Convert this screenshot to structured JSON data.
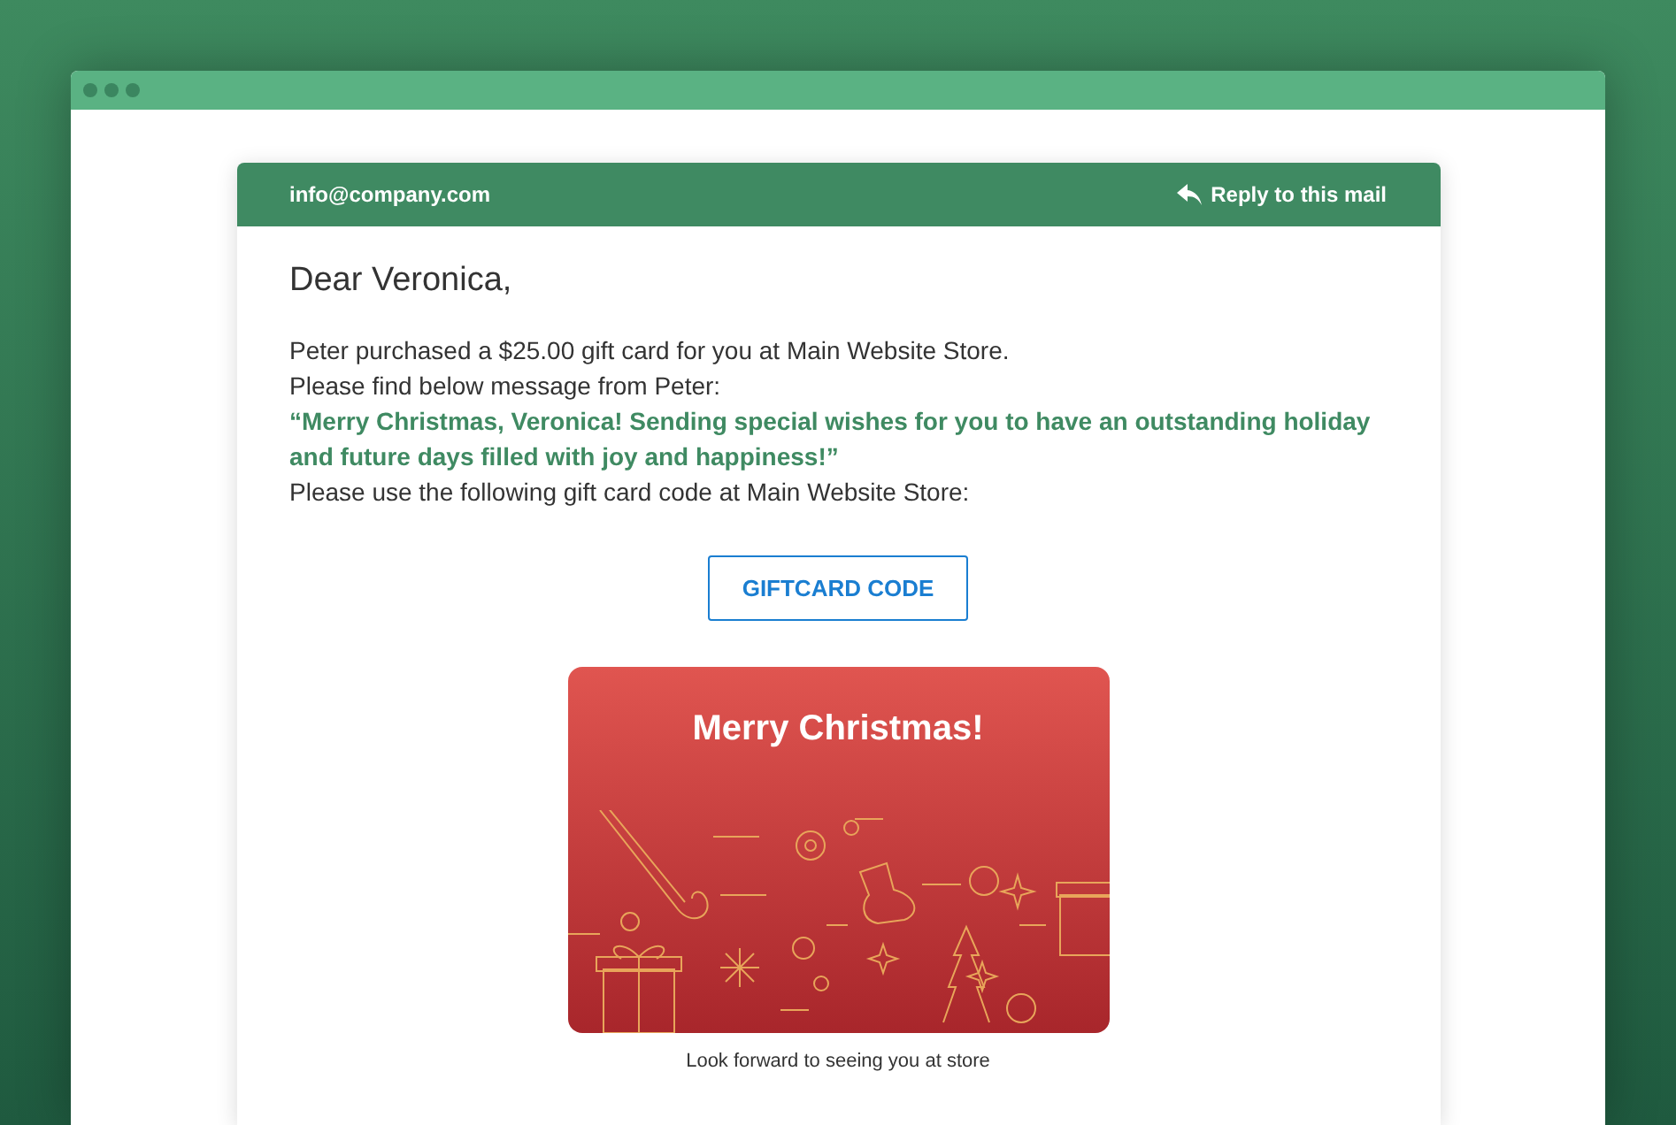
{
  "email": {
    "sender": "info@company.com",
    "reply_link": "Reply to this mail",
    "greeting": "Dear Veronica,",
    "lines": [
      {
        "kind": "plain",
        "text": "Peter purchased a $25.00 gift card for you at Main Website Store."
      },
      {
        "kind": "plain",
        "text": "Please find below message from Peter:"
      },
      {
        "kind": "quote",
        "text": "“Merry Christmas, Veronica! Sending special wishes for you to have an outstanding holiday and future days filled with joy and happiness!”"
      },
      {
        "kind": "plain",
        "text": "Please use the following gift card code at Main Website Store:"
      }
    ],
    "code_button": "GIFTCARD CODE",
    "card": {
      "title": "Merry Christmas!"
    },
    "caption": "Look forward to seeing you at store"
  }
}
